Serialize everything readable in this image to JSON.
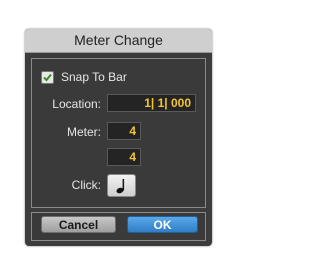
{
  "dialog": {
    "title": "Meter Change"
  },
  "snap": {
    "label": "Snap To Bar",
    "checked": true
  },
  "location": {
    "label": "Location:",
    "value": "1| 1| 000"
  },
  "meter": {
    "label": "Meter:",
    "numerator": "4",
    "denominator": "4"
  },
  "click": {
    "label": "Click:",
    "icon": "quarter-note-icon"
  },
  "buttons": {
    "cancel": "Cancel",
    "ok": "OK"
  },
  "colors": {
    "field_text": "#f4c430",
    "ok_button": "#3b8fd8",
    "panel_bg": "#3c3c3c"
  }
}
